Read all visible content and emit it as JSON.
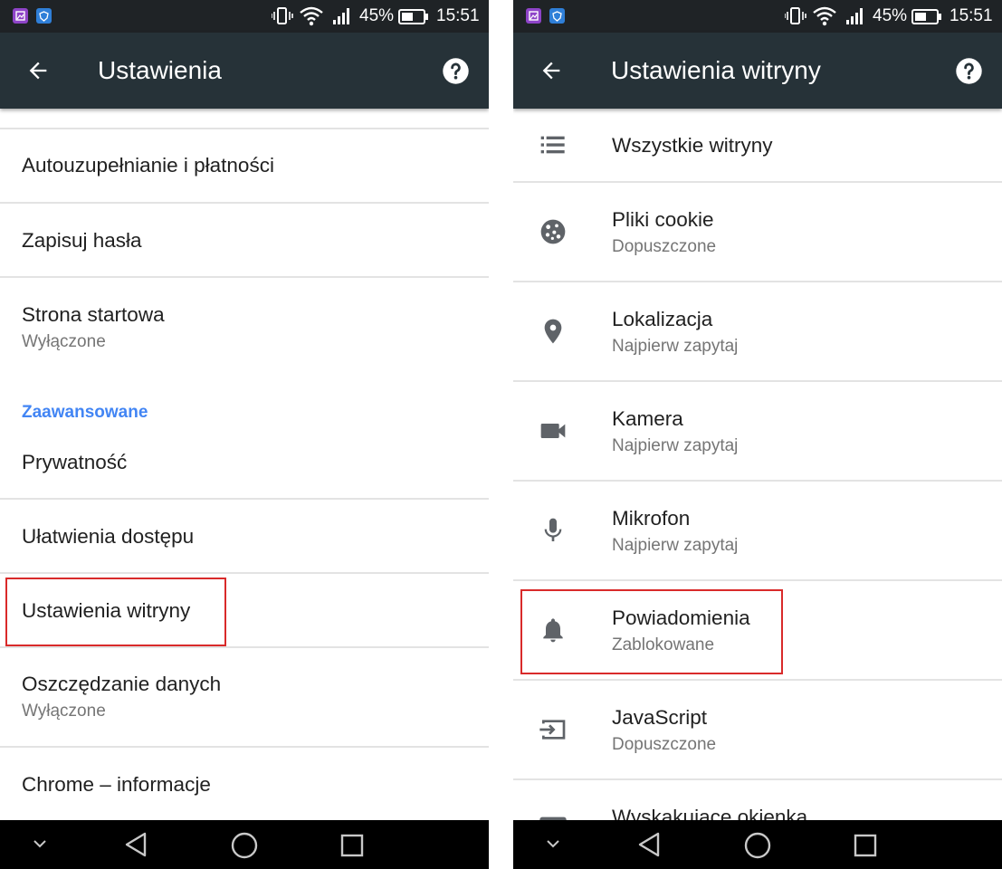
{
  "status_bar": {
    "battery_percent": "45%",
    "time": "15:51"
  },
  "left_screen": {
    "toolbar": {
      "title": "Ustawienia"
    },
    "items": [
      {
        "title": "Autouzupełnianie i płatności"
      },
      {
        "title": "Zapisuj hasła"
      },
      {
        "title": "Strona startowa",
        "subtitle": "Wyłączone"
      },
      {
        "section": "Zaawansowane"
      },
      {
        "title": "Prywatność"
      },
      {
        "title": "Ułatwienia dostępu"
      },
      {
        "title": "Ustawienia witryny",
        "highlighted": true
      },
      {
        "title": "Oszczędzanie danych",
        "subtitle": "Wyłączone"
      },
      {
        "title": "Chrome – informacje"
      }
    ]
  },
  "right_screen": {
    "toolbar": {
      "title": "Ustawienia witryny"
    },
    "items": [
      {
        "icon": "list-icon",
        "title": "Wszystkie witryny"
      },
      {
        "icon": "cookie-icon",
        "title": "Pliki cookie",
        "subtitle": "Dopuszczone"
      },
      {
        "icon": "location-pin-icon",
        "title": "Lokalizacja",
        "subtitle": "Najpierw zapytaj"
      },
      {
        "icon": "camera-icon",
        "title": "Kamera",
        "subtitle": "Najpierw zapytaj"
      },
      {
        "icon": "microphone-icon",
        "title": "Mikrofon",
        "subtitle": "Najpierw zapytaj"
      },
      {
        "icon": "bell-icon",
        "title": "Powiadomienia",
        "subtitle": "Zablokowane",
        "highlighted": true
      },
      {
        "icon": "javascript-icon",
        "title": "JavaScript",
        "subtitle": "Dopuszczone"
      },
      {
        "icon": "popup-icon",
        "title": "Wyskakujące okienka"
      }
    ]
  },
  "colors": {
    "toolbar": "#263238",
    "status_bar": "#1f2326",
    "accent_section": "#4285f4",
    "highlight_box": "#d92a2a",
    "primary_text": "#212121",
    "secondary_text": "#757575"
  }
}
